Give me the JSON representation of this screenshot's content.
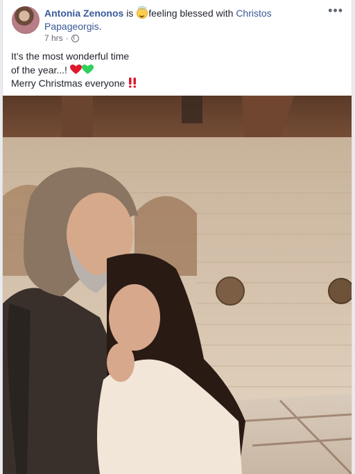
{
  "post": {
    "author": "Antonia Zenonos",
    "is_text": "is",
    "feeling_text": "feeling blessed with",
    "tagged_person": "Christos Papageorgis",
    "tagged_suffix": ".",
    "time": "7 hrs",
    "privacy_icon": "globe-icon",
    "more_icon": "ellipsis-icon",
    "text_line1": "It’s the most wonderful time",
    "text_line2": "of the year...!",
    "text_line3": "Merry Christmas everyone",
    "more_symbol": "•••"
  },
  "colors": {
    "link": "#385898",
    "text": "#1d2129",
    "meta": "#616770"
  }
}
